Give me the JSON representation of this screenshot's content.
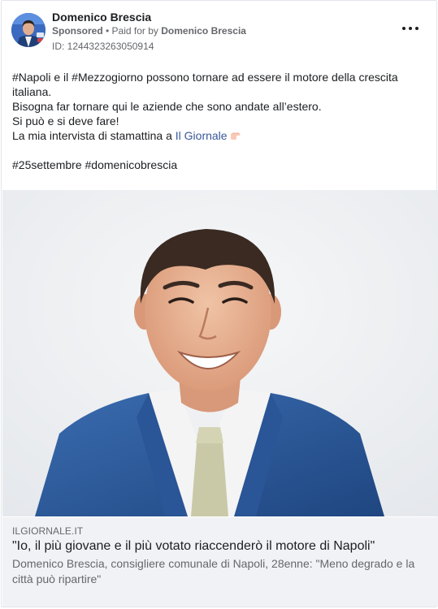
{
  "header": {
    "page_name": "Domenico Brescia",
    "sponsored_label": "Sponsored",
    "separator": " • ",
    "paid_for_prefix": "Paid for by ",
    "payer": "Domenico Brescia",
    "ad_id": "ID: 1244323263050914",
    "more_icon": "ellipsis-icon"
  },
  "post": {
    "line1": "#Napoli e il #Mezzogiorno possono tornare ad essere il motore della crescita italiana.",
    "line2": "Bisogna far tornare qui le aziende che sono andate all’estero.",
    "line3": "Si può e si deve fare!",
    "line4_prefix": "La mia intervista di stamattina a ",
    "line4_link": "Il Giornale",
    "line4_emoji": "pointing-finger-icon",
    "hashtags": "#25settembre #domenicobrescia"
  },
  "preview": {
    "domain": "ILGIORNALE.IT",
    "headline": "\"Io, il più giovane e il più votato riaccenderò il motore di Napoli\"",
    "description": "Domenico Brescia, consigliere comunale di Napoli, 28enne: \"Meno degrado e la città può ripartire\""
  },
  "colors": {
    "text": "#1c1e21",
    "secondary": "#65676b",
    "link": "#385898",
    "preview_bg": "#f0f2f5",
    "suit": "#2f5d9e"
  }
}
